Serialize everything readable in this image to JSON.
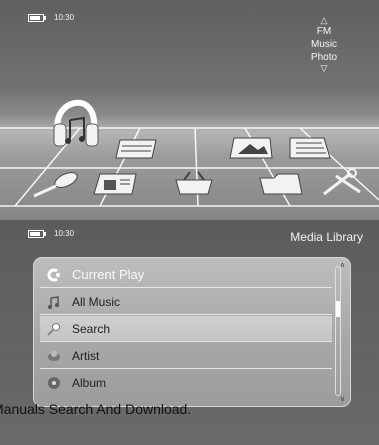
{
  "top_screen": {
    "status_time": "10:30",
    "mode_menu": [
      "FM",
      "Music",
      "Photo"
    ],
    "center_item": "Music",
    "tiles": [
      "headphones",
      "video",
      "photo",
      "notes",
      "microphone",
      "radio",
      "shopping-basket",
      "folder",
      "tools"
    ]
  },
  "bottom_screen": {
    "status_time": "10:30",
    "title": "Media Library",
    "items": [
      {
        "label": "Current Play",
        "icon": "current-play-icon"
      },
      {
        "label": "All Music",
        "icon": "music-note-icon"
      },
      {
        "label": "Search",
        "icon": "search-icon"
      },
      {
        "label": "Artist",
        "icon": "artist-icon"
      },
      {
        "label": "Album",
        "icon": "album-icon"
      }
    ],
    "selected_index": 2,
    "scroll_position": 0.3
  },
  "caption": "Manuals Search And Download."
}
